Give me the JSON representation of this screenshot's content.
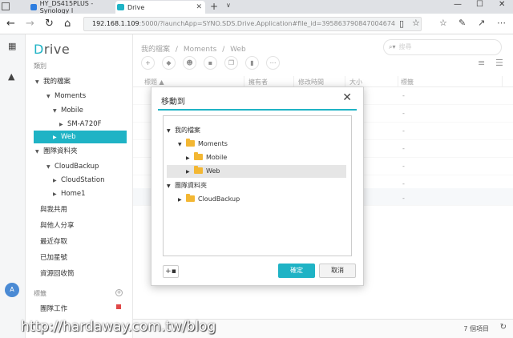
{
  "browser": {
    "tabs": [
      {
        "label": "HY_DS415PLUS - Synology I",
        "favicon_color": "#2d7de0"
      },
      {
        "label": "Drive",
        "favicon_color": "#1fb3c5"
      }
    ],
    "url_host": "192.168.1.109",
    "url_rest": ":5000/?launchApp=SYNO.SDS.Drive.Application#file_id=395863790847004674",
    "new_tab": "+",
    "tab_menu": "∨",
    "win_min": "—",
    "win_max": "☐",
    "win_close": "✕"
  },
  "sidebar": {
    "logo_first": "D",
    "logo_rest": "rive",
    "category_label": "類別",
    "tree": [
      {
        "label": "我的檔案",
        "caret": "▼"
      },
      {
        "label": "Moments",
        "caret": "▼"
      },
      {
        "label": "Mobile",
        "caret": "▼"
      },
      {
        "label": "SM-A720F",
        "caret": "▶"
      },
      {
        "label": "Web",
        "caret": "▶"
      },
      {
        "label": "團隊資料夾",
        "caret": "▼"
      },
      {
        "label": "CloudBackup",
        "caret": "▼"
      },
      {
        "label": "CloudStation",
        "caret": "▶"
      },
      {
        "label": "Home1",
        "caret": "▶"
      }
    ],
    "links": [
      "與我共用",
      "與他人分享",
      "最近存取",
      "已加星號",
      "資源回收筒"
    ],
    "labels_section": "標籤",
    "label_item": "團隊工作",
    "avatar": "A"
  },
  "main": {
    "breadcrumb": [
      "我的檔案",
      "/",
      "Moments",
      "/",
      "Web"
    ],
    "search_placeholder": "搜尋",
    "columns": [
      "標題 ▲",
      "擁有者",
      "修改時間",
      "大小",
      "標籤"
    ],
    "rows": [
      "-",
      "-",
      "-",
      "-",
      "-",
      "-",
      "-"
    ],
    "item_count": "7 個項目"
  },
  "modal": {
    "title": "移動到",
    "tree": [
      {
        "label": "我的檔案",
        "caret": "▼",
        "folder": false
      },
      {
        "label": "Moments",
        "caret": "▼",
        "folder": true
      },
      {
        "label": "Mobile",
        "caret": "▶",
        "folder": true
      },
      {
        "label": "Web",
        "caret": "▶",
        "folder": true
      },
      {
        "label": "團隊資料夾",
        "caret": "▼",
        "folder": false
      },
      {
        "label": "CloudBackup",
        "caret": "▶",
        "folder": true
      }
    ],
    "confirm": "確定",
    "cancel": "取消"
  },
  "watermark": "http://hardaway.com.tw/blog",
  "colors": {
    "accent": "#1fb3c5",
    "folder": "#f3b733",
    "label_red": "#e04848"
  }
}
